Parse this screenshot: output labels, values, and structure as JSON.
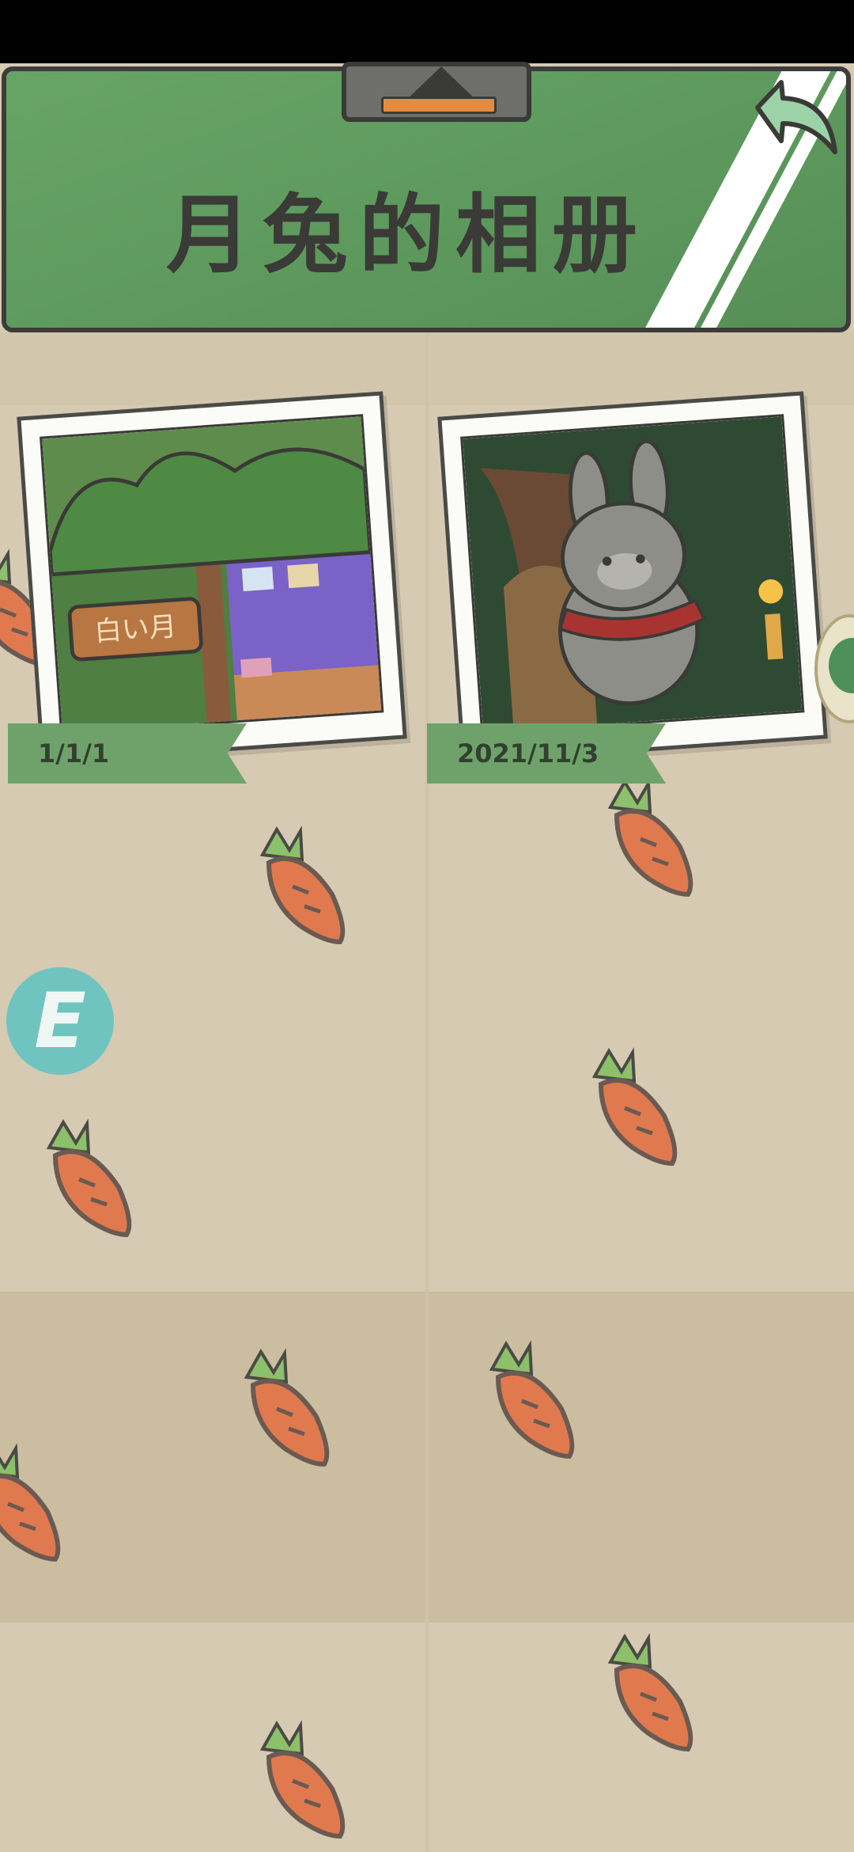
{
  "header": {
    "title": "月兔的相册"
  },
  "photos": [
    {
      "id": "photo-1",
      "date": "1/1/1",
      "sign_text": "白い月"
    },
    {
      "id": "photo-2",
      "date": "2021/11/3"
    }
  ],
  "floating": {
    "e_badge": "E"
  },
  "colors": {
    "header_green": "#5e9a5e",
    "ribbon_green": "#6fa26a",
    "background": "#d6cab2",
    "carrot_orange": "#e07a4e"
  }
}
